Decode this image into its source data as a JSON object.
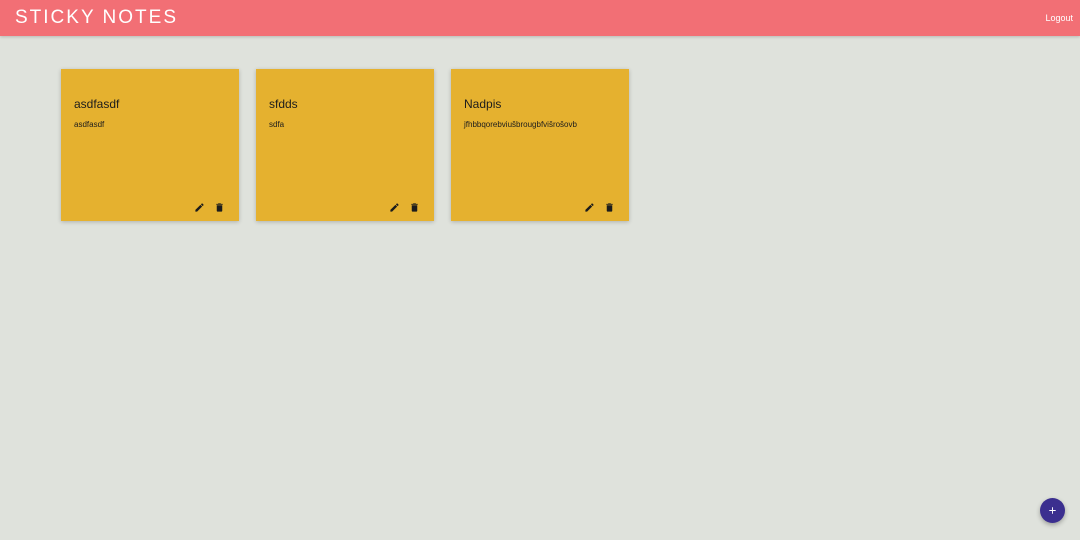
{
  "header": {
    "title": "STICKY NOTES",
    "logout_label": "Logout"
  },
  "notes": [
    {
      "title": "asdfasdf",
      "body": "asdfasdf",
      "edit_icon": "pencil-icon",
      "delete_icon": "trash-icon"
    },
    {
      "title": "sfdds",
      "body": "sdfa",
      "edit_icon": "pencil-icon",
      "delete_icon": "trash-icon"
    },
    {
      "title": "Nadpis",
      "body": "jfhbbqorebviušbrougbfvišrošovb",
      "edit_icon": "pencil-icon",
      "delete_icon": "trash-icon"
    }
  ],
  "fab": {
    "icon": "plus-icon"
  },
  "colors": {
    "header": "#f26f75",
    "background": "#dfe2dc",
    "note": "#e5b12f",
    "fab": "#3b2f8f"
  }
}
